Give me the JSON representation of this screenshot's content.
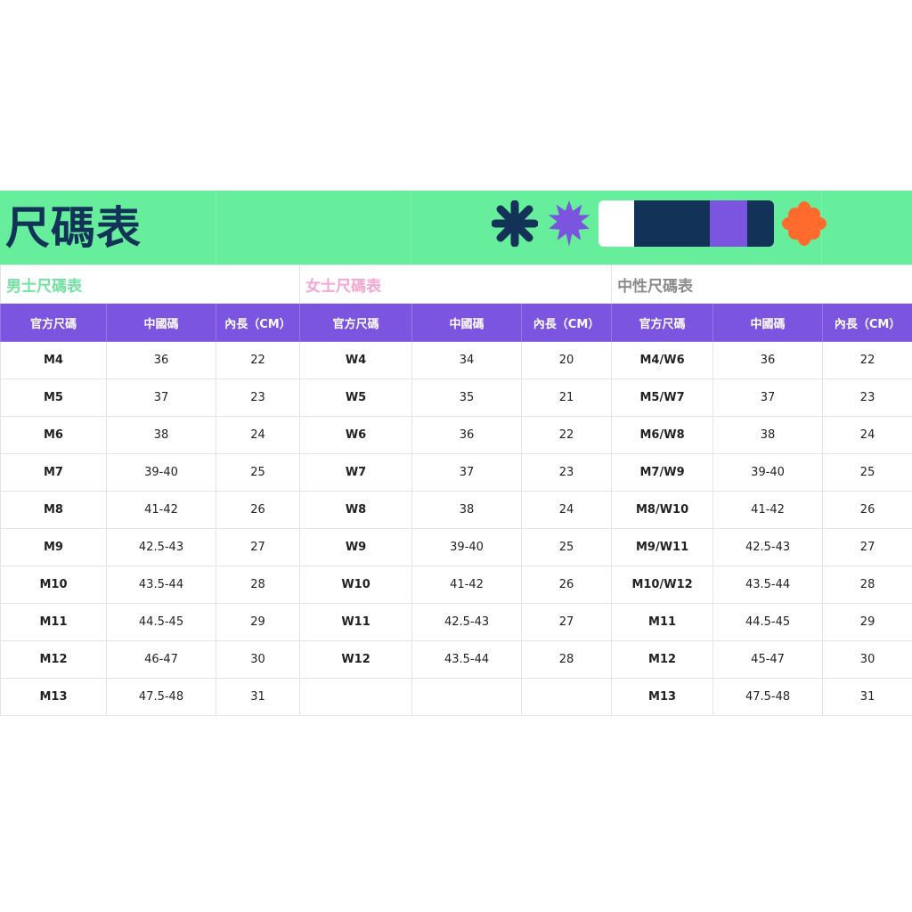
{
  "title": "尺碼表",
  "colors": {
    "banner_bg": "#66ee9c",
    "title": "#123258",
    "header_bg": "#7b55e0",
    "men_label": "#6fe3a0",
    "women_label": "#f6a6d2",
    "unisex_label": "#8c8c8c",
    "navy": "#123258",
    "purple": "#7b55e0",
    "orange": "#ff6b2c"
  },
  "decorations": [
    "asterisk-navy-icon",
    "starburst-purple-icon",
    "color-swatch-bar",
    "flower-orange-icon"
  ],
  "sections": [
    {
      "label": "男士尺碼表",
      "headers": [
        "官方尺碼",
        "中國碼",
        "內長（CM）"
      ],
      "rows": [
        [
          "M4",
          "36",
          "22"
        ],
        [
          "M5",
          "37",
          "23"
        ],
        [
          "M6",
          "38",
          "24"
        ],
        [
          "M7",
          "39-40",
          "25"
        ],
        [
          "M8",
          "41-42",
          "26"
        ],
        [
          "M9",
          "42.5-43",
          "27"
        ],
        [
          "M10",
          "43.5-44",
          "28"
        ],
        [
          "M11",
          "44.5-45",
          "29"
        ],
        [
          "M12",
          "46-47",
          "30"
        ],
        [
          "M13",
          "47.5-48",
          "31"
        ]
      ]
    },
    {
      "label": "女士尺碼表",
      "headers": [
        "官方尺碼",
        "中國碼",
        "內長（CM）"
      ],
      "rows": [
        [
          "W4",
          "34",
          "20"
        ],
        [
          "W5",
          "35",
          "21"
        ],
        [
          "W6",
          "36",
          "22"
        ],
        [
          "W7",
          "37",
          "23"
        ],
        [
          "W8",
          "38",
          "24"
        ],
        [
          "W9",
          "39-40",
          "25"
        ],
        [
          "W10",
          "41-42",
          "26"
        ],
        [
          "W11",
          "42.5-43",
          "27"
        ],
        [
          "W12",
          "43.5-44",
          "28"
        ],
        [
          "",
          "",
          ""
        ]
      ]
    },
    {
      "label": "中性尺碼表",
      "headers": [
        "官方尺碼",
        "中國碼",
        "內長（CM）"
      ],
      "rows": [
        [
          "M4/W6",
          "36",
          "22"
        ],
        [
          "M5/W7",
          "37",
          "23"
        ],
        [
          "M6/W8",
          "38",
          "24"
        ],
        [
          "M7/W9",
          "39-40",
          "25"
        ],
        [
          "M8/W10",
          "41-42",
          "26"
        ],
        [
          "M9/W11",
          "42.5-43",
          "27"
        ],
        [
          "M10/W12",
          "43.5-44",
          "28"
        ],
        [
          "M11",
          "44.5-45",
          "29"
        ],
        [
          "M12",
          "45-47",
          "30"
        ],
        [
          "M13",
          "47.5-48",
          "31"
        ]
      ]
    }
  ]
}
